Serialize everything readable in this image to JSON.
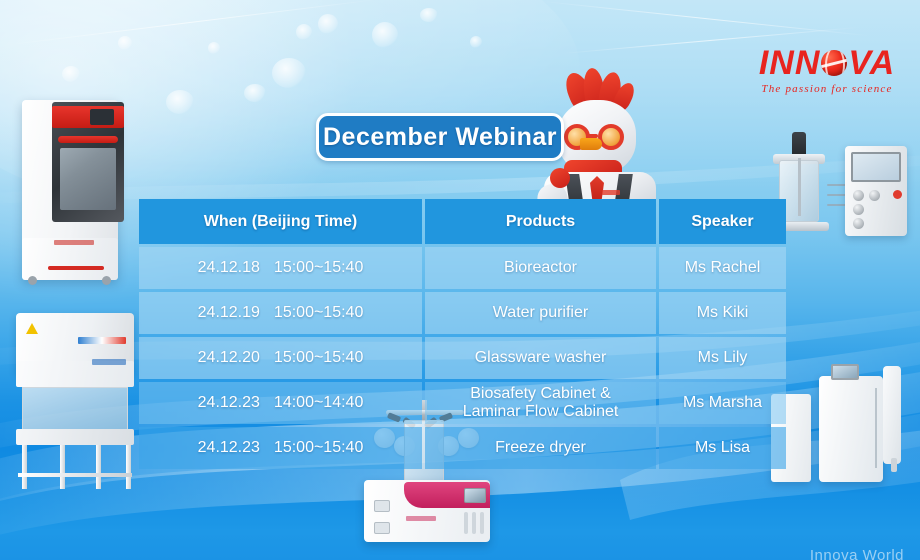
{
  "brand": {
    "logo_text": "INNOVA",
    "logo_part1": "INN",
    "logo_part2": "VA",
    "globe_icon": "globe-icon",
    "tagline": "The passion for science",
    "logo_color": "#e8241f"
  },
  "banner": {
    "title": "December  Webinar",
    "fill_color": "#1f7cc4",
    "border_color": "#ffffff",
    "text_color": "#ffffff"
  },
  "table": {
    "header_color": "#2196de",
    "columns": [
      "When (Beijing Time)",
      "Products",
      "Speaker"
    ],
    "rows": [
      {
        "date": "24.12.18",
        "time": "15:00~15:40",
        "product": "Bioreactor",
        "speaker": "Ms Rachel"
      },
      {
        "date": "24.12.19",
        "time": "15:00~15:40",
        "product": "Water purifier",
        "speaker": "Ms Kiki"
      },
      {
        "date": "24.12.20",
        "time": "15:00~15:40",
        "product": "Glassware washer",
        "speaker": "Ms Lily"
      },
      {
        "date": "24.12.23",
        "time": "14:00~14:40",
        "product": "Biosafety Cabinet &\nLaminar Flow Cabinet",
        "product_line1": "Biosafety Cabinet &",
        "product_line2": "Laminar Flow Cabinet",
        "speaker": "Ms Marsha"
      },
      {
        "date": "24.12.23",
        "time": "15:00~15:40",
        "product": "Freeze dryer",
        "speaker": "Ms Lisa"
      }
    ]
  },
  "decorations": {
    "mascot": "rooster-scientist-mascot",
    "equipment": [
      "glassware-washer-photo",
      "biosafety-cabinet-photo",
      "bioreactor-photo",
      "water-purifier-photo",
      "freeze-dryer-photo"
    ],
    "background_top_color": "#a9dcf4",
    "background_bottom_color": "#0f8ae2"
  },
  "footer": {
    "cropped_text": "Innova World"
  }
}
